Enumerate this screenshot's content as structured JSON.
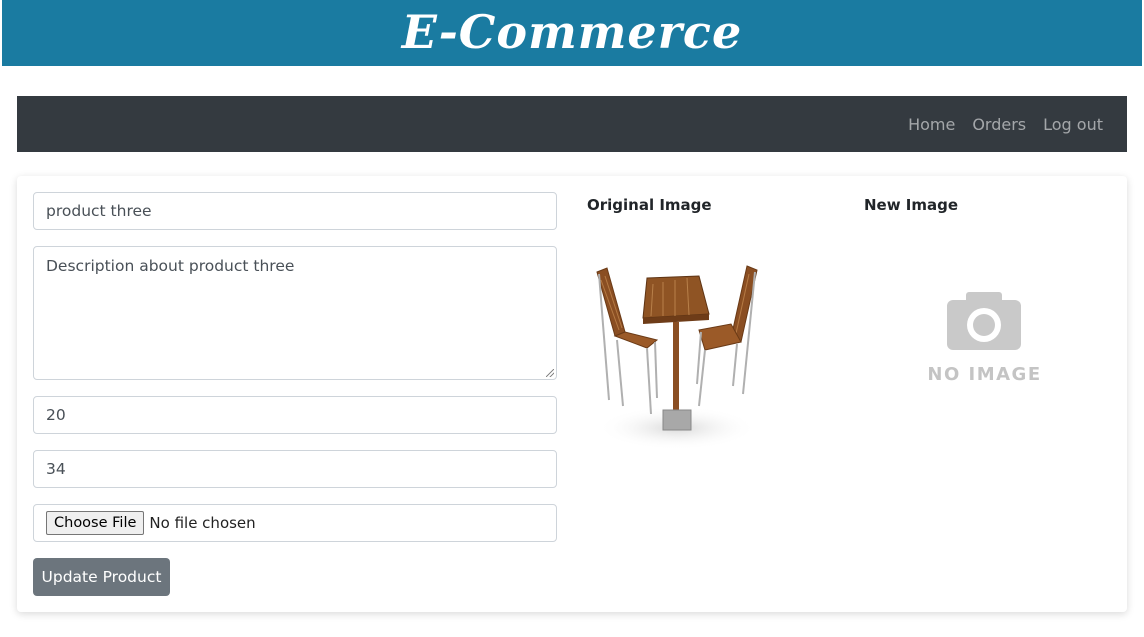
{
  "banner": {
    "title": "E-Commerce"
  },
  "nav": {
    "links": [
      {
        "label": "Home"
      },
      {
        "label": "Orders"
      },
      {
        "label": "Log out"
      }
    ]
  },
  "form": {
    "name_value": "product three",
    "description_value": "Description about product three",
    "price_value": "20",
    "quantity_value": "34",
    "file": {
      "button_label": "Choose File",
      "status": "No file chosen"
    },
    "submit_label": "Update Product"
  },
  "images": {
    "original_label": "Original Image",
    "new_label": "New Image",
    "placeholder_text": "NO IMAGE"
  },
  "colors": {
    "banner": "#1a7ba1",
    "navbar": "#343a40",
    "button": "#6c757d"
  }
}
